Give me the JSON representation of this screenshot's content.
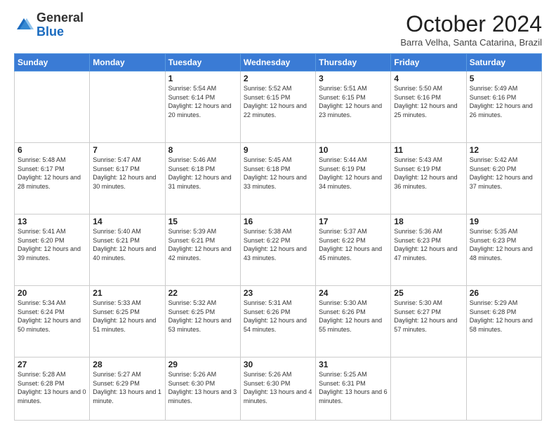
{
  "header": {
    "logo_general": "General",
    "logo_blue": "Blue",
    "title": "October 2024",
    "location": "Barra Velha, Santa Catarina, Brazil"
  },
  "days_of_week": [
    "Sunday",
    "Monday",
    "Tuesday",
    "Wednesday",
    "Thursday",
    "Friday",
    "Saturday"
  ],
  "weeks": [
    [
      {
        "day": "",
        "info": ""
      },
      {
        "day": "",
        "info": ""
      },
      {
        "day": "1",
        "info": "Sunrise: 5:54 AM\nSunset: 6:14 PM\nDaylight: 12 hours and 20 minutes."
      },
      {
        "day": "2",
        "info": "Sunrise: 5:52 AM\nSunset: 6:15 PM\nDaylight: 12 hours and 22 minutes."
      },
      {
        "day": "3",
        "info": "Sunrise: 5:51 AM\nSunset: 6:15 PM\nDaylight: 12 hours and 23 minutes."
      },
      {
        "day": "4",
        "info": "Sunrise: 5:50 AM\nSunset: 6:16 PM\nDaylight: 12 hours and 25 minutes."
      },
      {
        "day": "5",
        "info": "Sunrise: 5:49 AM\nSunset: 6:16 PM\nDaylight: 12 hours and 26 minutes."
      }
    ],
    [
      {
        "day": "6",
        "info": "Sunrise: 5:48 AM\nSunset: 6:17 PM\nDaylight: 12 hours and 28 minutes."
      },
      {
        "day": "7",
        "info": "Sunrise: 5:47 AM\nSunset: 6:17 PM\nDaylight: 12 hours and 30 minutes."
      },
      {
        "day": "8",
        "info": "Sunrise: 5:46 AM\nSunset: 6:18 PM\nDaylight: 12 hours and 31 minutes."
      },
      {
        "day": "9",
        "info": "Sunrise: 5:45 AM\nSunset: 6:18 PM\nDaylight: 12 hours and 33 minutes."
      },
      {
        "day": "10",
        "info": "Sunrise: 5:44 AM\nSunset: 6:19 PM\nDaylight: 12 hours and 34 minutes."
      },
      {
        "day": "11",
        "info": "Sunrise: 5:43 AM\nSunset: 6:19 PM\nDaylight: 12 hours and 36 minutes."
      },
      {
        "day": "12",
        "info": "Sunrise: 5:42 AM\nSunset: 6:20 PM\nDaylight: 12 hours and 37 minutes."
      }
    ],
    [
      {
        "day": "13",
        "info": "Sunrise: 5:41 AM\nSunset: 6:20 PM\nDaylight: 12 hours and 39 minutes."
      },
      {
        "day": "14",
        "info": "Sunrise: 5:40 AM\nSunset: 6:21 PM\nDaylight: 12 hours and 40 minutes."
      },
      {
        "day": "15",
        "info": "Sunrise: 5:39 AM\nSunset: 6:21 PM\nDaylight: 12 hours and 42 minutes."
      },
      {
        "day": "16",
        "info": "Sunrise: 5:38 AM\nSunset: 6:22 PM\nDaylight: 12 hours and 43 minutes."
      },
      {
        "day": "17",
        "info": "Sunrise: 5:37 AM\nSunset: 6:22 PM\nDaylight: 12 hours and 45 minutes."
      },
      {
        "day": "18",
        "info": "Sunrise: 5:36 AM\nSunset: 6:23 PM\nDaylight: 12 hours and 47 minutes."
      },
      {
        "day": "19",
        "info": "Sunrise: 5:35 AM\nSunset: 6:23 PM\nDaylight: 12 hours and 48 minutes."
      }
    ],
    [
      {
        "day": "20",
        "info": "Sunrise: 5:34 AM\nSunset: 6:24 PM\nDaylight: 12 hours and 50 minutes."
      },
      {
        "day": "21",
        "info": "Sunrise: 5:33 AM\nSunset: 6:25 PM\nDaylight: 12 hours and 51 minutes."
      },
      {
        "day": "22",
        "info": "Sunrise: 5:32 AM\nSunset: 6:25 PM\nDaylight: 12 hours and 53 minutes."
      },
      {
        "day": "23",
        "info": "Sunrise: 5:31 AM\nSunset: 6:26 PM\nDaylight: 12 hours and 54 minutes."
      },
      {
        "day": "24",
        "info": "Sunrise: 5:30 AM\nSunset: 6:26 PM\nDaylight: 12 hours and 55 minutes."
      },
      {
        "day": "25",
        "info": "Sunrise: 5:30 AM\nSunset: 6:27 PM\nDaylight: 12 hours and 57 minutes."
      },
      {
        "day": "26",
        "info": "Sunrise: 5:29 AM\nSunset: 6:28 PM\nDaylight: 12 hours and 58 minutes."
      }
    ],
    [
      {
        "day": "27",
        "info": "Sunrise: 5:28 AM\nSunset: 6:28 PM\nDaylight: 13 hours and 0 minutes."
      },
      {
        "day": "28",
        "info": "Sunrise: 5:27 AM\nSunset: 6:29 PM\nDaylight: 13 hours and 1 minute."
      },
      {
        "day": "29",
        "info": "Sunrise: 5:26 AM\nSunset: 6:30 PM\nDaylight: 13 hours and 3 minutes."
      },
      {
        "day": "30",
        "info": "Sunrise: 5:26 AM\nSunset: 6:30 PM\nDaylight: 13 hours and 4 minutes."
      },
      {
        "day": "31",
        "info": "Sunrise: 5:25 AM\nSunset: 6:31 PM\nDaylight: 13 hours and 6 minutes."
      },
      {
        "day": "",
        "info": ""
      },
      {
        "day": "",
        "info": ""
      }
    ]
  ]
}
